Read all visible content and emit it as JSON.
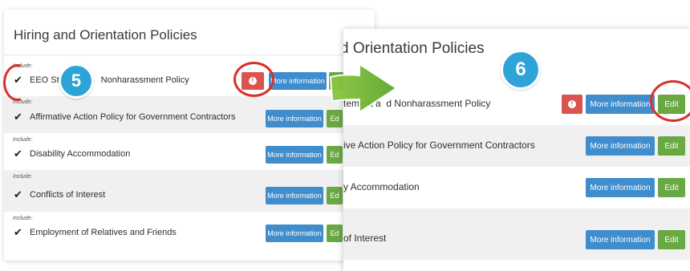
{
  "left": {
    "title": "Hiring and Orientation Policies",
    "rows": [
      {
        "include": "Include:",
        "label": "EEO Statement and Nonharassment Policy",
        "label_visible": "EEO Sta               Nonharassment Policy",
        "more": "More information",
        "edit": "Edit",
        "alert": "!"
      },
      {
        "include": "Include:",
        "label": "Affirmative Action Policy for Government Contractors",
        "more": "More information",
        "edit": "Ed"
      },
      {
        "include": "Include:",
        "label": "Disability Accommodation",
        "more": "More information",
        "edit": "Ed"
      },
      {
        "include": "Include:",
        "label": "Conflicts of Interest",
        "more": "More information",
        "edit": "Ed"
      },
      {
        "include": "Include:",
        "label": "Employment of Relatives and Friends",
        "more": "More information",
        "edit": "Ed"
      }
    ]
  },
  "right": {
    "title": "d Orientation Policies",
    "rows": [
      {
        "label": "tement a  d Nonharassment Policy",
        "more": "More information",
        "edit": "Edit",
        "alert": "!"
      },
      {
        "label": "ive Action Policy for Government Contractors",
        "more": "More information",
        "edit": "Edit"
      },
      {
        "label": "y Accommodation",
        "more": "More information",
        "edit": "Edit"
      },
      {
        "label": "of Interest",
        "more": "More information",
        "edit": "Edit"
      }
    ]
  },
  "steps": {
    "five": "5",
    "six": "6"
  },
  "icons": {
    "check": "checkmark-icon",
    "alert": "alert-icon",
    "arrow": "arrow-right-icon"
  },
  "colors": {
    "info": "#3f8dcc",
    "edit": "#6aa844",
    "alert": "#d9534f",
    "badge": "#2da3d8",
    "annotation": "#d9302b"
  }
}
